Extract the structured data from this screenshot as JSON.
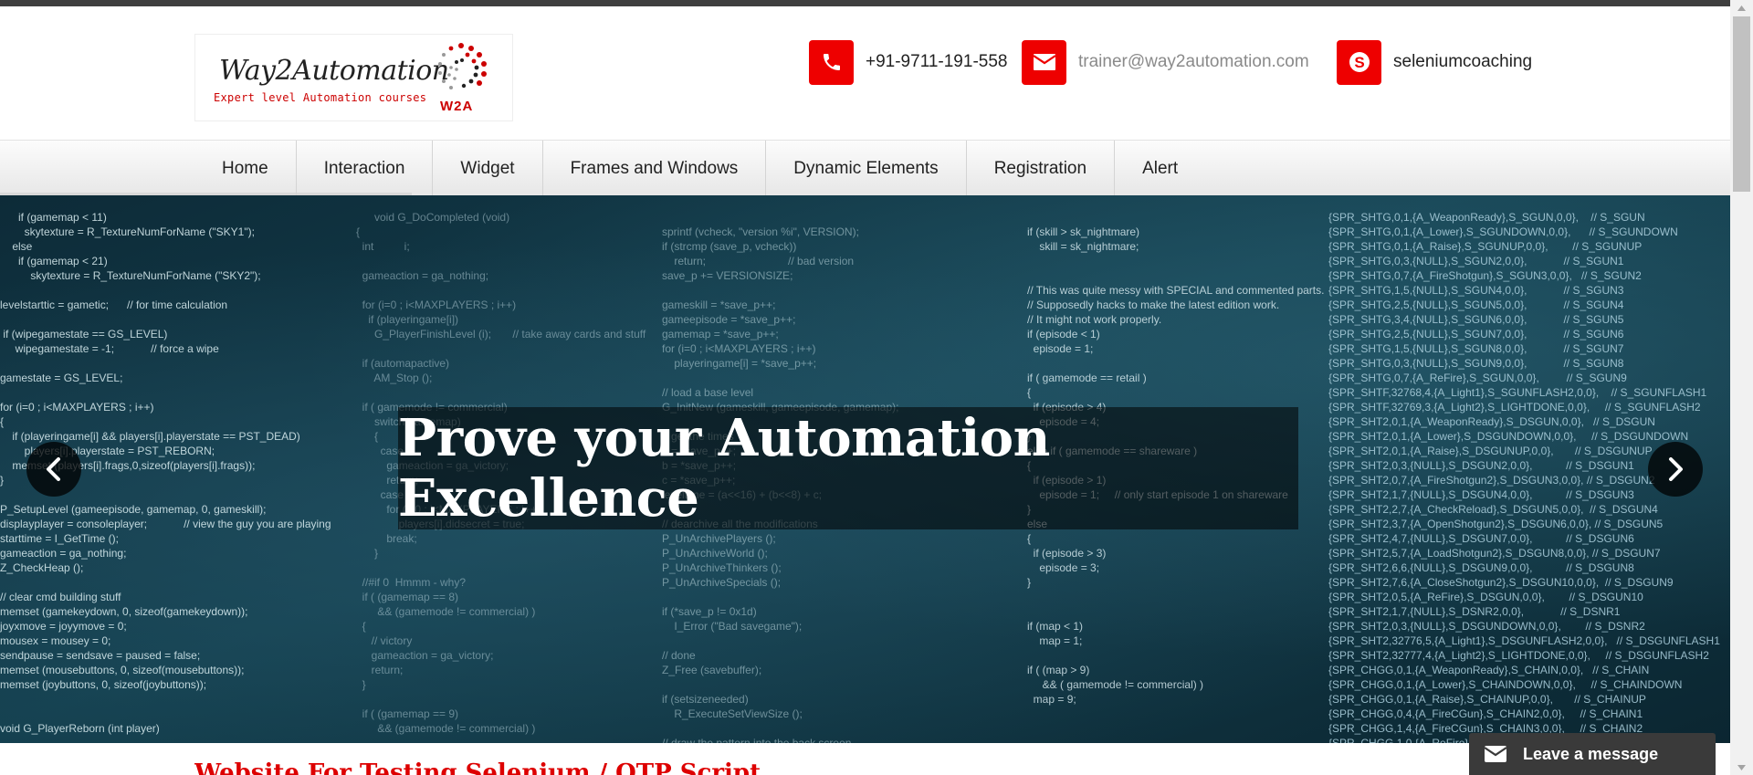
{
  "header": {
    "logo": {
      "brand": "Way2Automation",
      "tagline": "Expert level Automation courses",
      "mark": "W2A"
    },
    "contacts": [
      {
        "icon": "phone-icon",
        "text": "+91-9711-191-558"
      },
      {
        "icon": "envelope-icon",
        "text": "trainer@way2automation.com"
      },
      {
        "icon": "skype-icon",
        "text": "seleniumcoaching"
      }
    ]
  },
  "nav": {
    "items": [
      "Home",
      "Interaction",
      "Widget",
      "Frames and Windows",
      "Dynamic Elements",
      "Registration",
      "Alert"
    ]
  },
  "hero": {
    "caption": "Prove your Automation Excellence",
    "prev_icon": "chevron-left-icon",
    "next_icon": "chevron-right-icon"
  },
  "below": {
    "title": "Website For Testing Selenium / QTP Script"
  },
  "chat": {
    "label": "Leave a message",
    "icon": "envelope-icon"
  },
  "colors": {
    "accent": "#ee0000",
    "nav_bg": "#f0f0f0",
    "chat_bg": "#3a3a3a"
  }
}
